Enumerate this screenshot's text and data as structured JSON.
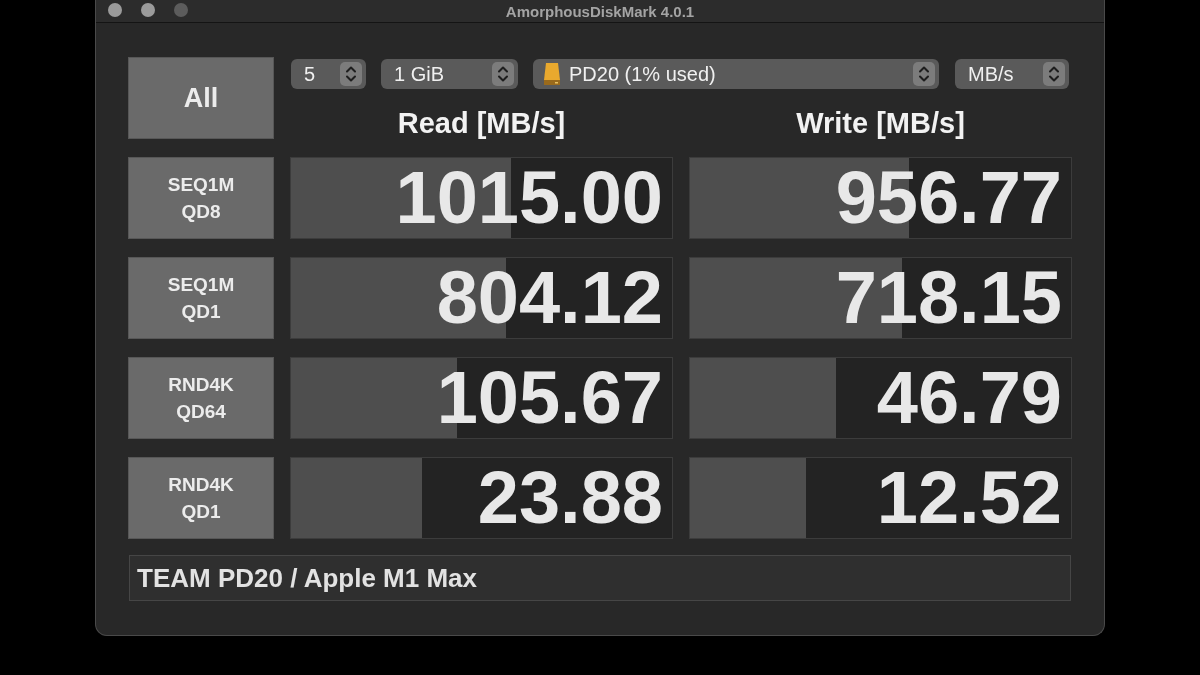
{
  "window": {
    "title": "AmorphousDiskMark 4.0.1"
  },
  "controls": {
    "all_button": "All",
    "selectors": [
      {
        "kind": "count",
        "value": "5"
      },
      {
        "kind": "size",
        "value": "1 GiB"
      },
      {
        "kind": "drive",
        "value": "PD20 (1% used)"
      },
      {
        "kind": "unit",
        "value": "MB/s"
      }
    ]
  },
  "columns": [
    "Read [MB/s]",
    "Write [MB/s]"
  ],
  "tests": [
    {
      "label_lines": [
        "SEQ1M",
        "QD8"
      ],
      "results": [
        {
          "value": "1015.00",
          "level": 0.577
        },
        {
          "value": "956.77",
          "level": 0.574
        }
      ]
    },
    {
      "label_lines": [
        "SEQ1M",
        "QD1"
      ],
      "results": [
        {
          "value": "804.12",
          "level": 0.564
        },
        {
          "value": "718.15",
          "level": 0.556
        }
      ]
    },
    {
      "label_lines": [
        "RND4K",
        "QD64"
      ],
      "results": [
        {
          "value": "105.67",
          "level": 0.436
        },
        {
          "value": "46.79",
          "level": 0.384
        }
      ]
    },
    {
      "label_lines": [
        "RND4K",
        "QD1"
      ],
      "results": [
        {
          "value": "23.88",
          "level": 0.345
        },
        {
          "value": "12.52",
          "level": 0.305
        }
      ]
    }
  ],
  "comment": {
    "value": "TEAM PD20 / Apple M1 Max"
  }
}
